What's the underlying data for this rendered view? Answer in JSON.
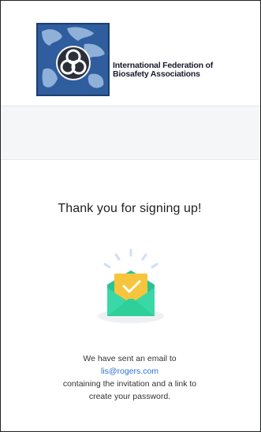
{
  "brand": {
    "line1": "International Federation of",
    "line2": "Biosafety Associations"
  },
  "confirmation": {
    "title": "Thank you for signing up!",
    "line1": "We have sent an email to",
    "email": "lis@rogers.com",
    "line3": "containing the invitation and a link to",
    "line4": "create your password."
  },
  "colors": {
    "accent": "#2b6fd6",
    "envelope_green": "#2fcf9a",
    "letter_yellow": "#f6c53b",
    "logo_blue": "#2f5d9e"
  },
  "icons": {
    "logo": "biohazard-globe-logo",
    "illustration": "envelope-check-icon"
  }
}
